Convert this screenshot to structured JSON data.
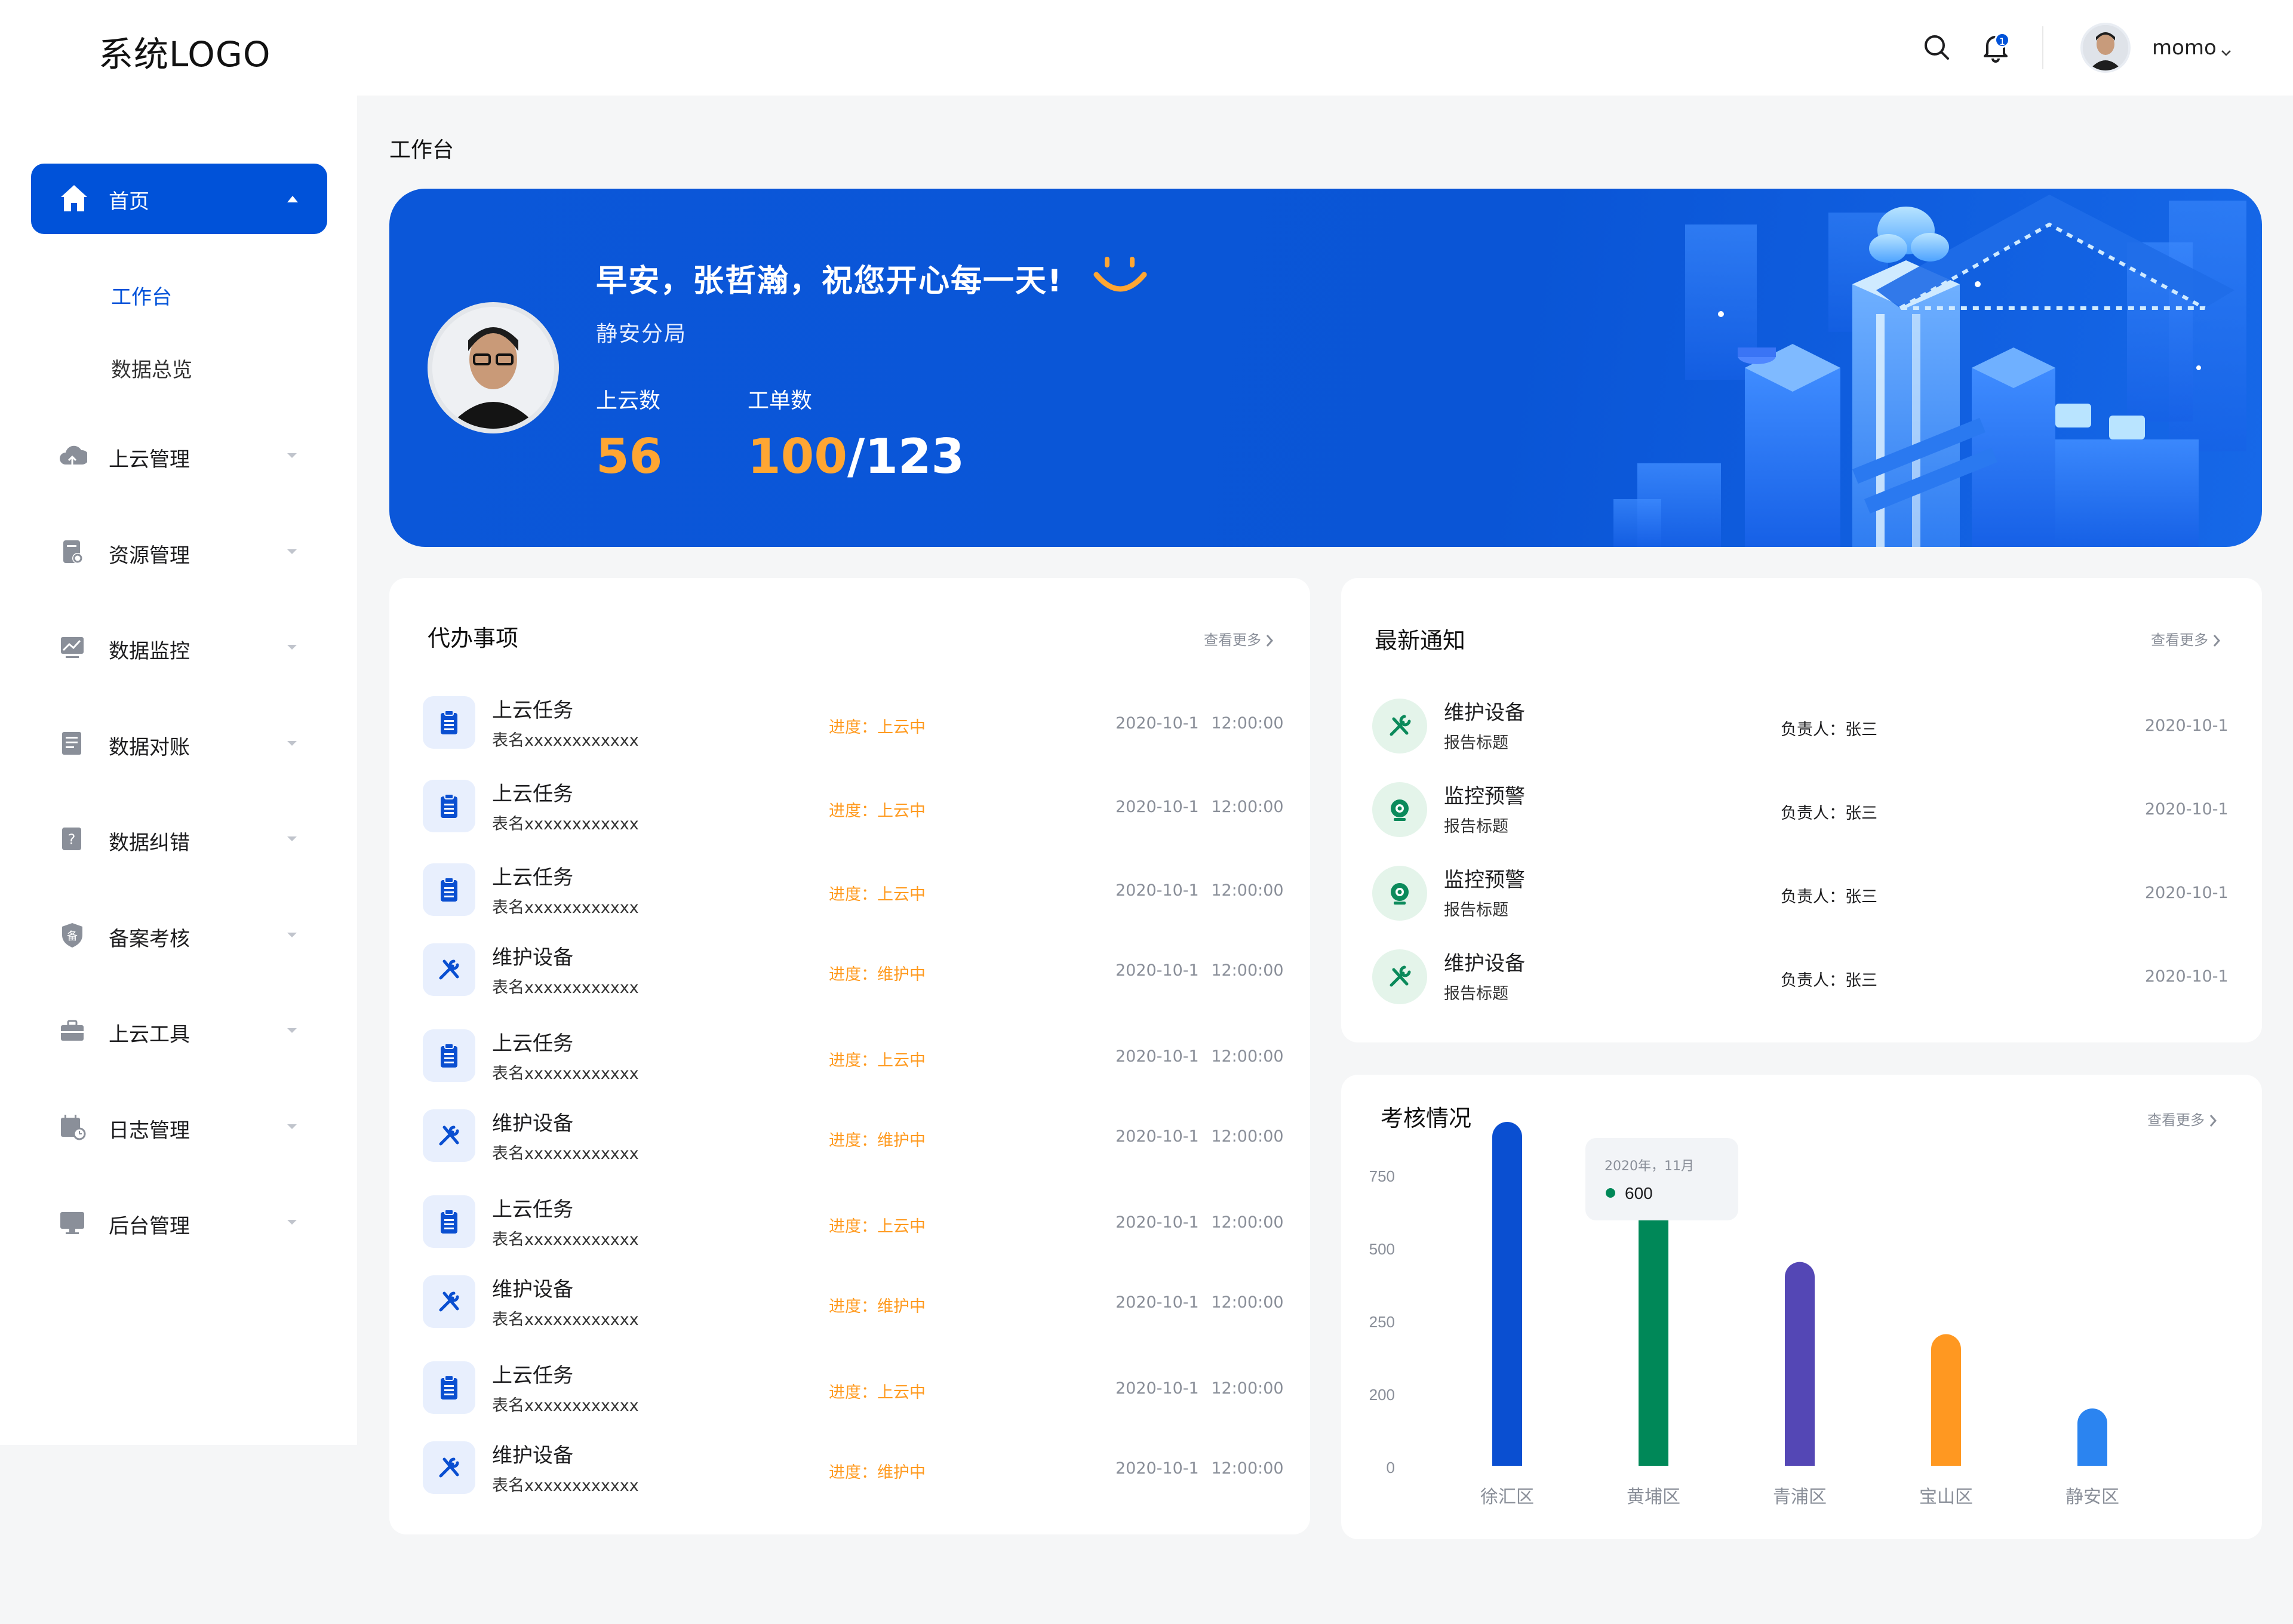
{
  "header": {
    "logo": "系统LOGO",
    "notification_count": "1",
    "username": "momo"
  },
  "sidebar": {
    "home": {
      "label": "首页",
      "icon": "home-icon"
    },
    "home_children": [
      {
        "label": "工作台",
        "active": true
      },
      {
        "label": "数据总览",
        "active": false
      }
    ],
    "items": [
      {
        "label": "上云管理",
        "icon": "cloud-upload-icon"
      },
      {
        "label": "资源管理",
        "icon": "resource-file-icon"
      },
      {
        "label": "数据监控",
        "icon": "monitor-chart-icon"
      },
      {
        "label": "数据对账",
        "icon": "ledger-icon"
      },
      {
        "label": "数据纠错",
        "icon": "question-doc-icon"
      },
      {
        "label": "备案考核",
        "icon": "shield-badge-icon"
      },
      {
        "label": "上云工具",
        "icon": "toolbox-icon"
      },
      {
        "label": "日志管理",
        "icon": "calendar-log-icon"
      },
      {
        "label": "后台管理",
        "icon": "desktop-icon"
      }
    ],
    "accent": "#0052d9"
  },
  "page": {
    "breadcrumb": "工作台"
  },
  "banner": {
    "greeting": "早安，张哲瀚，祝您开心每一天!",
    "department": "静安分局",
    "stats": [
      {
        "label": "上云数",
        "value": "56"
      },
      {
        "label": "工单数",
        "value_done": "100",
        "value_total": "/123"
      }
    ],
    "colors": {
      "background": "#0b57d9",
      "highlight": "#ffa632"
    }
  },
  "todo": {
    "title": "代办事项",
    "more": "查看更多",
    "items": [
      {
        "type": "clipboard-icon",
        "title": "上云任务",
        "subtitle": "表名xxxxxxxxxxxx",
        "progress": "进度：上云中",
        "time": "2020-10-1 12:00:00"
      },
      {
        "type": "clipboard-icon",
        "title": "上云任务",
        "subtitle": "表名xxxxxxxxxxxx",
        "progress": "进度：上云中",
        "time": "2020-10-1 12:00:00"
      },
      {
        "type": "clipboard-icon",
        "title": "上云任务",
        "subtitle": "表名xxxxxxxxxxxx",
        "progress": "进度：上云中",
        "time": "2020-10-1 12:00:00"
      },
      {
        "type": "wrench-icon",
        "title": "维护设备",
        "subtitle": "表名xxxxxxxxxxxx",
        "progress": "进度：维护中",
        "time": "2020-10-1 12:00:00"
      },
      {
        "type": "clipboard-icon",
        "title": "上云任务",
        "subtitle": "表名xxxxxxxxxxxx",
        "progress": "进度：上云中",
        "time": "2020-10-1 12:00:00"
      },
      {
        "type": "wrench-icon",
        "title": "维护设备",
        "subtitle": "表名xxxxxxxxxxxx",
        "progress": "进度：维护中",
        "time": "2020-10-1 12:00:00"
      },
      {
        "type": "clipboard-icon",
        "title": "上云任务",
        "subtitle": "表名xxxxxxxxxxxx",
        "progress": "进度：上云中",
        "time": "2020-10-1 12:00:00"
      },
      {
        "type": "wrench-icon",
        "title": "维护设备",
        "subtitle": "表名xxxxxxxxxxxx",
        "progress": "进度：维护中",
        "time": "2020-10-1 12:00:00"
      },
      {
        "type": "clipboard-icon",
        "title": "上云任务",
        "subtitle": "表名xxxxxxxxxxxx",
        "progress": "进度：上云中",
        "time": "2020-10-1 12:00:00"
      },
      {
        "type": "wrench-icon",
        "title": "维护设备",
        "subtitle": "表名xxxxxxxxxxxx",
        "progress": "进度：维护中",
        "time": "2020-10-1 12:00:00"
      }
    ]
  },
  "notices": {
    "title": "最新通知",
    "more": "查看更多",
    "items": [
      {
        "type": "tools-icon",
        "title": "维护设备",
        "subtitle": "报告标题",
        "owner": "负责人：张三",
        "date": "2020-10-1"
      },
      {
        "type": "camera-icon",
        "title": "监控预警",
        "subtitle": "报告标题",
        "owner": "负责人：张三",
        "date": "2020-10-1"
      },
      {
        "type": "camera-icon",
        "title": "监控预警",
        "subtitle": "报告标题",
        "owner": "负责人：张三",
        "date": "2020-10-1"
      },
      {
        "type": "tools-icon",
        "title": "维护设备",
        "subtitle": "报告标题",
        "owner": "负责人：张三",
        "date": "2020-10-1"
      }
    ],
    "icon_color": "#0b8a5b"
  },
  "assessment": {
    "title": "考核情况",
    "more": "查看更多",
    "tooltip": {
      "date": "2020年，11月",
      "value": "600"
    }
  },
  "chart_data": {
    "type": "bar",
    "title": "考核情况",
    "categories": [
      "徐汇区",
      "黄埔区",
      "青浦区",
      "宝山区",
      "静安区"
    ],
    "values": [
      810,
      660,
      480,
      310,
      135
    ],
    "colors": [
      "#0a4fd1",
      "#008858",
      "#5447b5",
      "#ff9821",
      "#2b84f0"
    ],
    "ytick_labels": [
      "0",
      "200",
      "250",
      "500",
      "750"
    ],
    "tooltip": {
      "category": "黄埔区",
      "label": "2020年，11月",
      "value": 600
    },
    "grid": false,
    "legend": "none"
  }
}
